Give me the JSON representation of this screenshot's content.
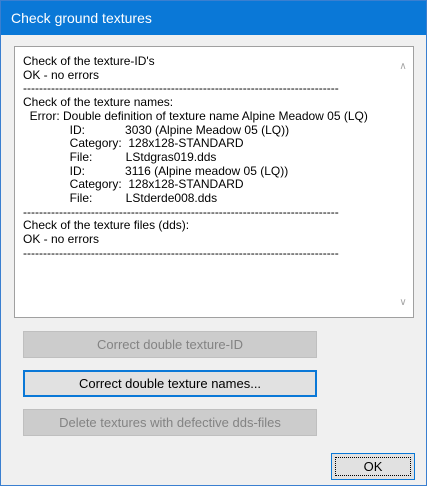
{
  "window": {
    "title": "Check ground textures",
    "accent_color": "#0a78d7"
  },
  "report": {
    "text": "Check of the texture-ID's\nOK - no errors\n-------------------------------------------------------------------------------\nCheck of the texture names:\n  Error: Double definition of texture name Alpine Meadow 05 (LQ)\n              ID:            3030 (Alpine Meadow 05 (LQ))\n              Category:  128x128-STANDARD\n              File:          LStdgras019.dds\n              ID:            3116 (Alpine meadow 05 (LQ))\n              Category:  128x128-STANDARD\n              File:          LStderde008.dds\n-------------------------------------------------------------------------------\nCheck of the texture files (dds):\nOK - no errors\n-------------------------------------------------------------------------------",
    "scroll_up_icon": "chevron-up-icon",
    "scroll_down_icon": "chevron-down-icon"
  },
  "buttons": {
    "correct_ids": "Correct double texture-ID",
    "correct_names": "Correct double texture names...",
    "delete_defective": "Delete textures with defective dds-files",
    "ok": "OK"
  }
}
